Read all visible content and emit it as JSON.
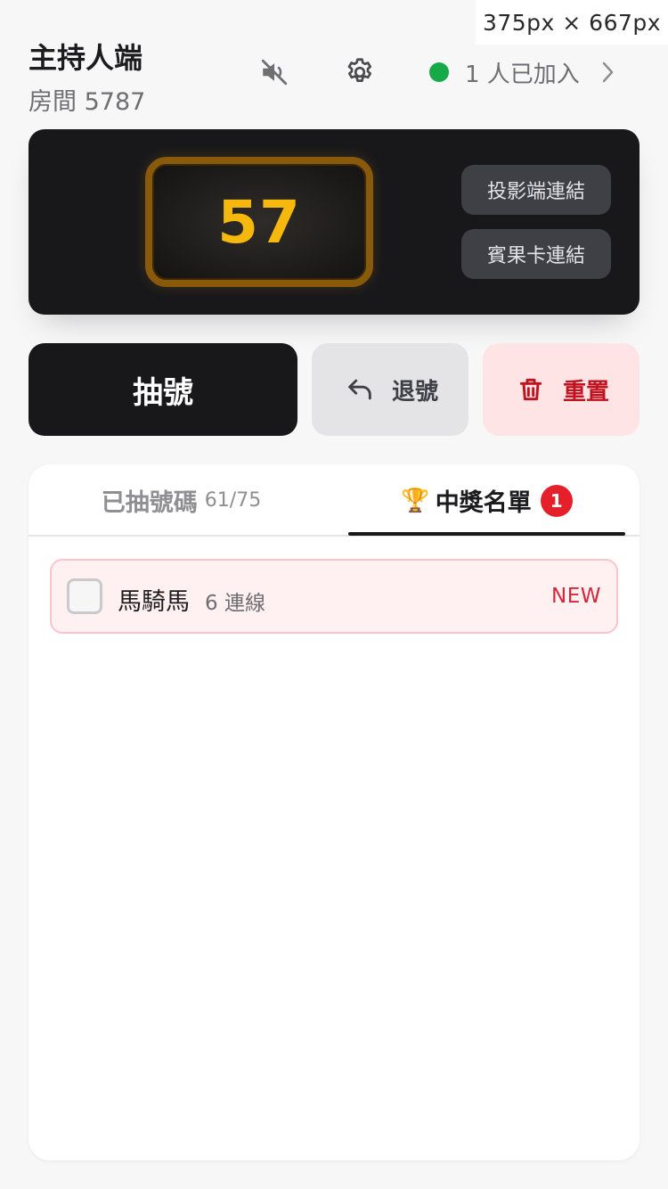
{
  "viewport_label": "375px × 667px",
  "header": {
    "title": "主持人端",
    "room_label": "房間 5787",
    "players_text": "1 人已加入",
    "icons": {
      "mute": "speaker-muted-icon",
      "settings": "gear-icon",
      "online": "green-dot",
      "chevron": "chevron-right-icon"
    }
  },
  "board": {
    "current_number": "57",
    "projector_link_label": "投影端連結",
    "bingo_card_link_label": "賓果卡連結"
  },
  "actions": {
    "draw_label": "抽號",
    "undo_label": "退號",
    "reset_label": "重置"
  },
  "tabs": {
    "drawn_label": "已抽號碼",
    "drawn_count": "61/75",
    "winners_icon": "🏆",
    "winners_label": "中獎名單",
    "winners_badge": "1",
    "active": "winners"
  },
  "winners": [
    {
      "name": "馬騎馬",
      "lines": "6 連線",
      "tag": "NEW",
      "checked": false
    }
  ],
  "colors": {
    "accent_gold": "#f6b80c",
    "online_green": "#17a847",
    "danger_red": "#c1121f",
    "dark": "#18181b"
  }
}
